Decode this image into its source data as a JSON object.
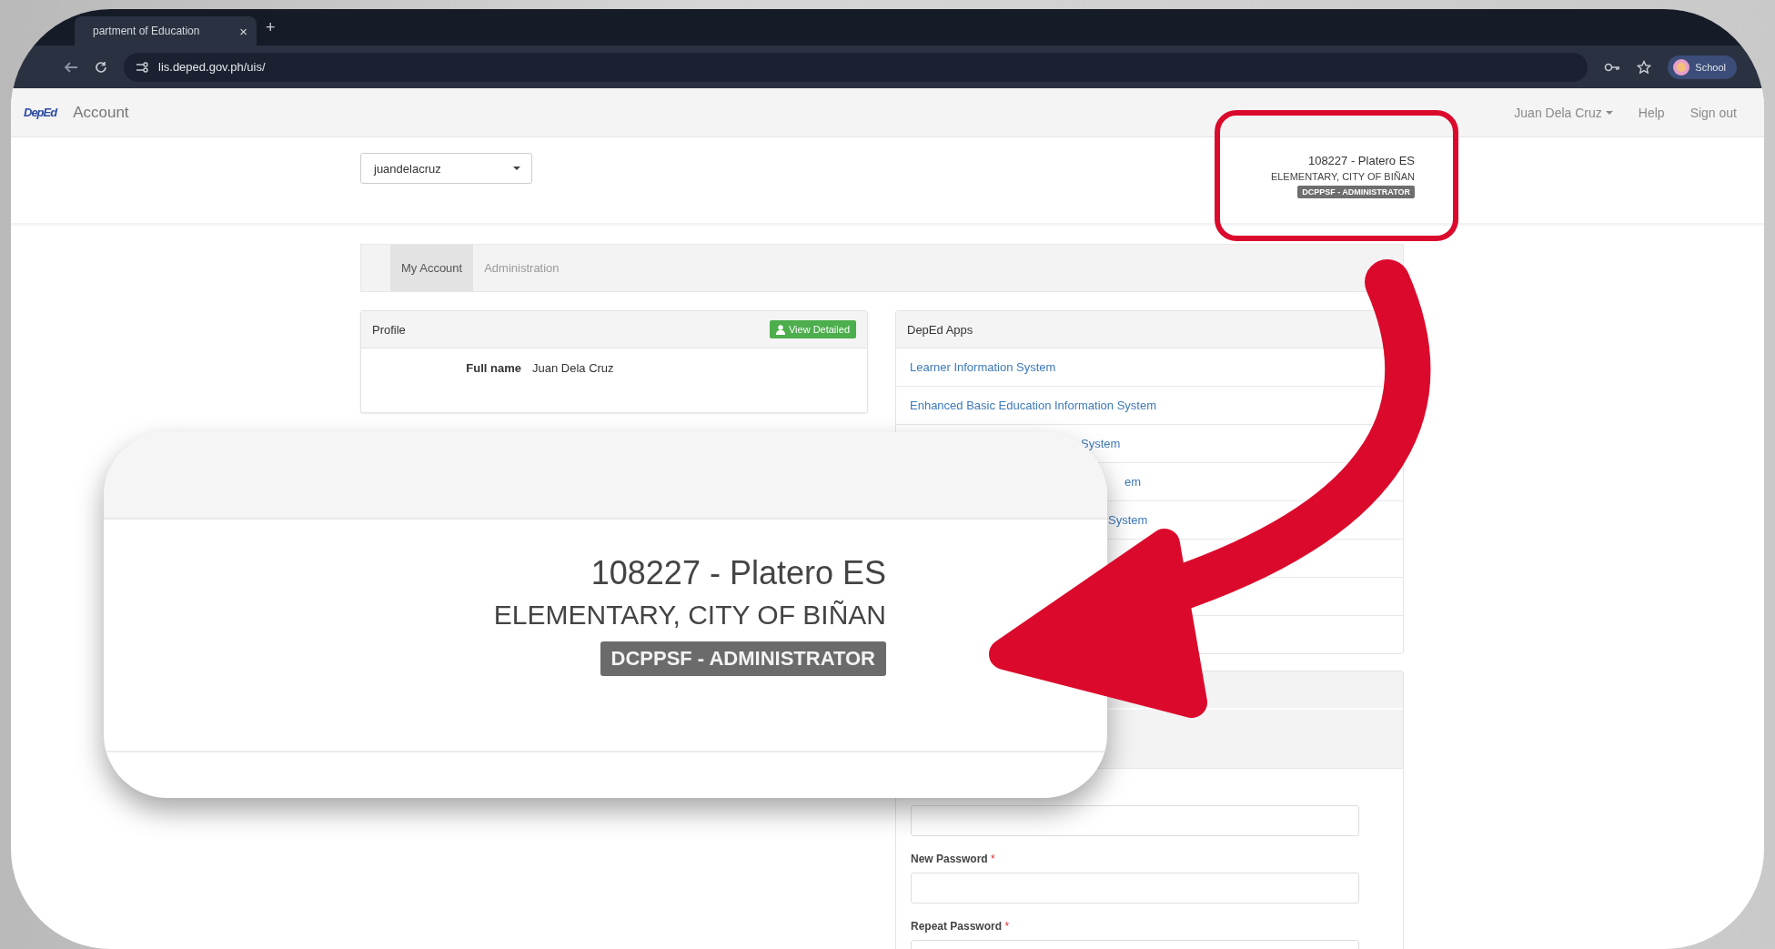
{
  "browser": {
    "tab": {
      "title": "partment of Education",
      "close": "×"
    },
    "new_tab": "+",
    "url": "lis.deped.gov.ph/uis/",
    "profile": "School"
  },
  "navbar": {
    "logo": "DepEd",
    "title": "Account",
    "user": "Juan Dela Cruz",
    "links": [
      "Help",
      "Sign out"
    ]
  },
  "header": {
    "select": {
      "value": "juandelacruz"
    },
    "school": {
      "name": "108227 - Platero ES",
      "type": "ELEMENTARY, CITY OF BIÑAN",
      "role": "DCPPSF - ADMINISTRATOR"
    }
  },
  "tabs": [
    {
      "label": "My Account",
      "selected": true
    },
    {
      "label": "Administration",
      "selected": false
    }
  ],
  "profile": {
    "title": "Profile",
    "button": "View Detailed",
    "fields": [
      {
        "label": "Full name",
        "value": "Juan Dela Cruz"
      }
    ]
  },
  "apps": {
    "title": "DepEd Apps",
    "items": [
      {
        "label": "Learner Information System",
        "kind": "full"
      },
      {
        "label": "Enhanced Basic Education Information System",
        "kind": "full"
      },
      {
        "label": "System",
        "kind": "partial"
      },
      {
        "label": "em",
        "kind": "partial"
      },
      {
        "label": "System",
        "kind": "partial"
      }
    ]
  },
  "password": {
    "fields": [
      {
        "kind": "input"
      },
      {
        "kind": "input",
        "label": "New Password",
        "required": "*"
      },
      {
        "kind": "input",
        "label": "Repeat Password",
        "required": "*"
      }
    ]
  },
  "callout": {
    "name": "108227 - Platero ES",
    "type": "ELEMENTARY, CITY OF BIÑAN",
    "role": "DCPPSF - ADMINISTRATOR"
  }
}
